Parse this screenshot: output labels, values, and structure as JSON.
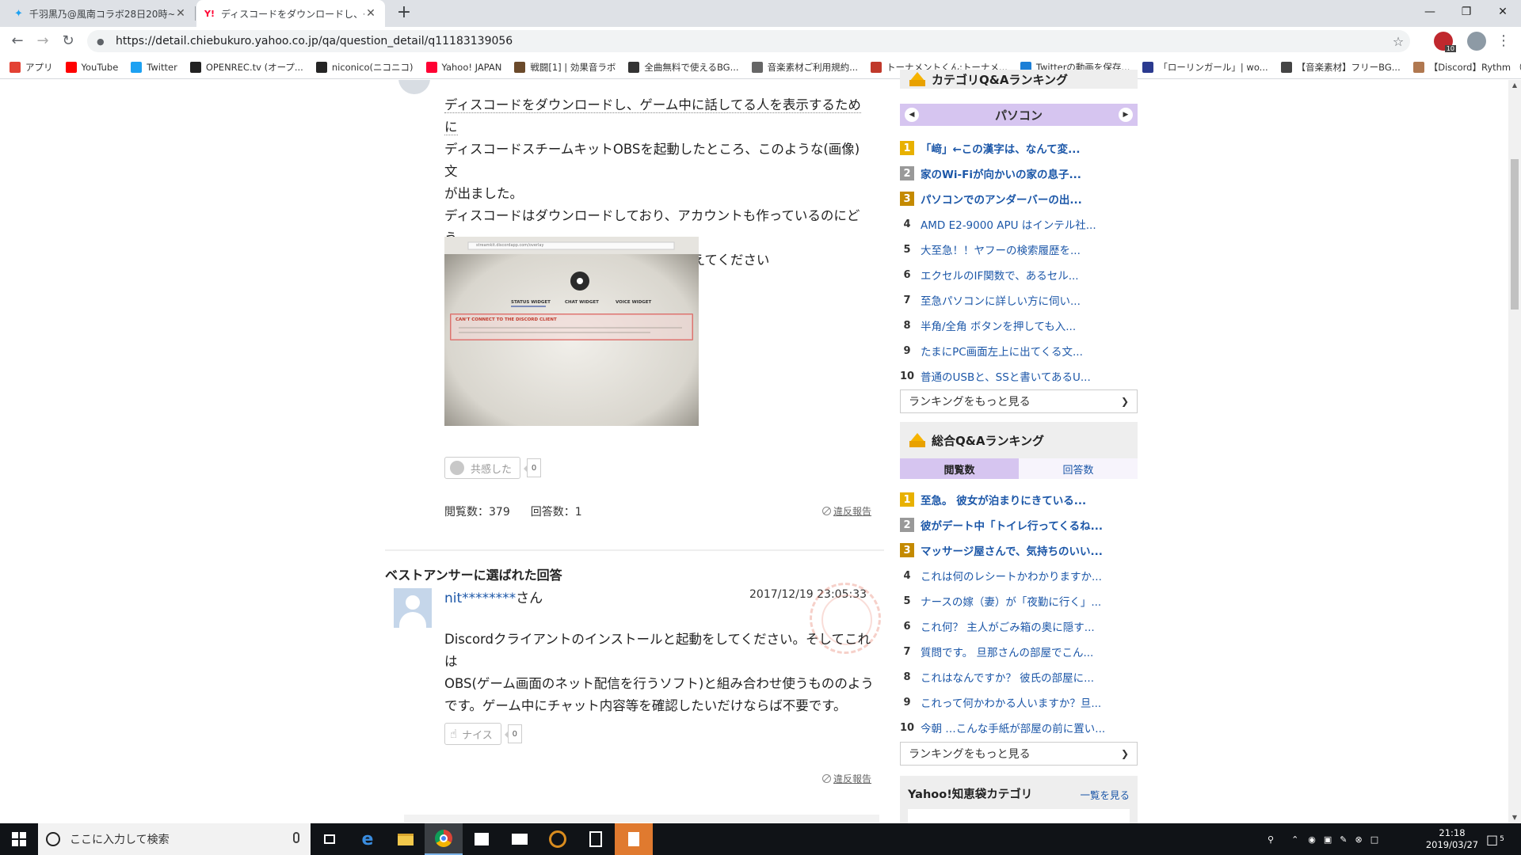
{
  "browser": {
    "tabs": [
      {
        "title": "千羽黒乃@風南コラボ28日20時~",
        "active": false
      },
      {
        "title": "ディスコードをダウンロードし、ゲーム中に",
        "active": true
      }
    ],
    "url": "https://detail.chiebukuro.yahoo.co.jp/qa/question_detail/q11183139056",
    "ext_badge": "10",
    "bookmarks": [
      {
        "label": "アプリ",
        "icon": "apps-grid-icon",
        "color": "#e34133"
      },
      {
        "label": "YouTube",
        "icon": "youtube-icon",
        "color": "#ff0000"
      },
      {
        "label": "Twitter",
        "icon": "twitter-icon",
        "color": "#1da1f2"
      },
      {
        "label": "OPENREC.tv (オープ...",
        "icon": "openrec-icon",
        "color": "#222222"
      },
      {
        "label": "niconico(ニコニコ)",
        "icon": "niconico-icon",
        "color": "#252525"
      },
      {
        "label": "Yahoo! JAPAN",
        "icon": "yahoo-icon",
        "color": "#ff0033"
      },
      {
        "label": "戦闘[1] | 効果音ラボ",
        "icon": "soundlab-icon",
        "color": "#6b4a2b"
      },
      {
        "label": "全曲無料で使えるBG...",
        "icon": "bgm-icon",
        "color": "#333333"
      },
      {
        "label": "音楽素材ご利用規約...",
        "icon": "page-icon",
        "color": "#666666"
      },
      {
        "label": "トーナメントくん:トーナメ...",
        "icon": "tournament-icon",
        "color": "#c0392b"
      },
      {
        "label": "Twitterの動画を保存...",
        "icon": "twitter-save-icon",
        "color": "#1c7fd6"
      },
      {
        "label": "「ローリンガール」| wo...",
        "icon": "square-icon",
        "color": "#2b3a8f"
      },
      {
        "label": "【音楽素材】フリーBG...",
        "icon": "music-icon",
        "color": "#444444"
      },
      {
        "label": "【Discord】Rythm （...",
        "icon": "discord-page-icon",
        "color": "#b07850"
      }
    ]
  },
  "question": {
    "lines": [
      "ディスコードをダウンロードし、ゲーム中に話してる人を表示するために",
      "ディスコードスチームキットOBSを起動したところ、このような(画像)文",
      "が出ました。",
      "ディスコードはダウンロードしており、アカウントも作っているのにどう",
      "して出るのでしょうか、原因と解決法を教えてください"
    ],
    "image_caption_small": "streamkit.discordapp.com/overlay",
    "image_tabs": [
      "STATUS WIDGET",
      "CHAT WIDGET",
      "VOICE WIDGET"
    ],
    "image_error_title": "CAN'T CONNECT TO THE DISCORD CLIENT",
    "empathy_label": "共感した",
    "empathy_count": "0",
    "views_label": "閲覧数：379",
    "answers_label": "回答数：1",
    "report_label": "違反報告"
  },
  "best_answer": {
    "heading": "ベストアンサーに選ばれた回答",
    "username": "nit********",
    "honorific": "さん",
    "date": "2017/12/19 23:05:33",
    "lines": [
      "Discordクライアントのインストールと起動をしてください。そしてこれは",
      "OBS(ゲーム画面のネット配信を行うソフト)と組み合わせ使うもののよう",
      "です。ゲーム中にチャット内容等を確認したいだけならば不要です。"
    ],
    "nice_label": "ナイス",
    "nice_count": "0",
    "report_label": "違反報告"
  },
  "category_ranking": {
    "title": "カテゴリQ&Aランキング",
    "category": "パソコン",
    "items": [
      {
        "rank": "1",
        "text": "「﨑」←この漢字は、なんて変..."
      },
      {
        "rank": "2",
        "text": "家のWi-Fiが向かいの家の息子..."
      },
      {
        "rank": "3",
        "text": "パソコンでのアンダーバーの出..."
      },
      {
        "rank": "4",
        "text": "AMD E2-9000 APU はインテル社..."
      },
      {
        "rank": "5",
        "text": "大至急！！ヤフーの検索履歴を..."
      },
      {
        "rank": "6",
        "text": "エクセルのIF関数で、あるセル..."
      },
      {
        "rank": "7",
        "text": "至急パソコンに詳しい方に伺い..."
      },
      {
        "rank": "8",
        "text": "半角/全角 ボタンを押しても入..."
      },
      {
        "rank": "9",
        "text": "たまにPC画面左上に出てくる文..."
      },
      {
        "rank": "10",
        "text": "普通のUSBと、SSと書いてあるU..."
      }
    ],
    "more_label": "ランキングをもっと見る"
  },
  "overall_ranking": {
    "title": "総合Q&Aランキング",
    "tabs": [
      "閲覧数",
      "回答数"
    ],
    "items": [
      {
        "rank": "1",
        "text": "至急。 彼女が泊まりにきている..."
      },
      {
        "rank": "2",
        "text": "彼がデート中「トイレ行ってくるね..."
      },
      {
        "rank": "3",
        "text": "マッサージ屋さんで、気持ちのいい..."
      },
      {
        "rank": "4",
        "text": "これは何のレシートかわかりますか..."
      },
      {
        "rank": "5",
        "text": "ナースの嫁（妻）が「夜勤に行く」..."
      },
      {
        "rank": "6",
        "text": "これ何？ 主人がごみ箱の奥に隠す..."
      },
      {
        "rank": "7",
        "text": "質問です。 旦那さんの部屋でこん..."
      },
      {
        "rank": "8",
        "text": "これはなんですか？ 彼氏の部屋に..."
      },
      {
        "rank": "9",
        "text": "これって何かわかる人いますか？旦..."
      },
      {
        "rank": "10",
        "text": "今朝 …こんな手紙が部屋の前に置い..."
      }
    ],
    "more_label": "ランキングをもっと見る"
  },
  "yahoo_categories": {
    "title": "Yahoo!知恵袋カテゴリ",
    "link": "一覧を見る"
  },
  "taskbar": {
    "search_placeholder": "ここに入力して検索",
    "time": "21:18",
    "date": "2019/03/27",
    "notification_count": "5"
  }
}
